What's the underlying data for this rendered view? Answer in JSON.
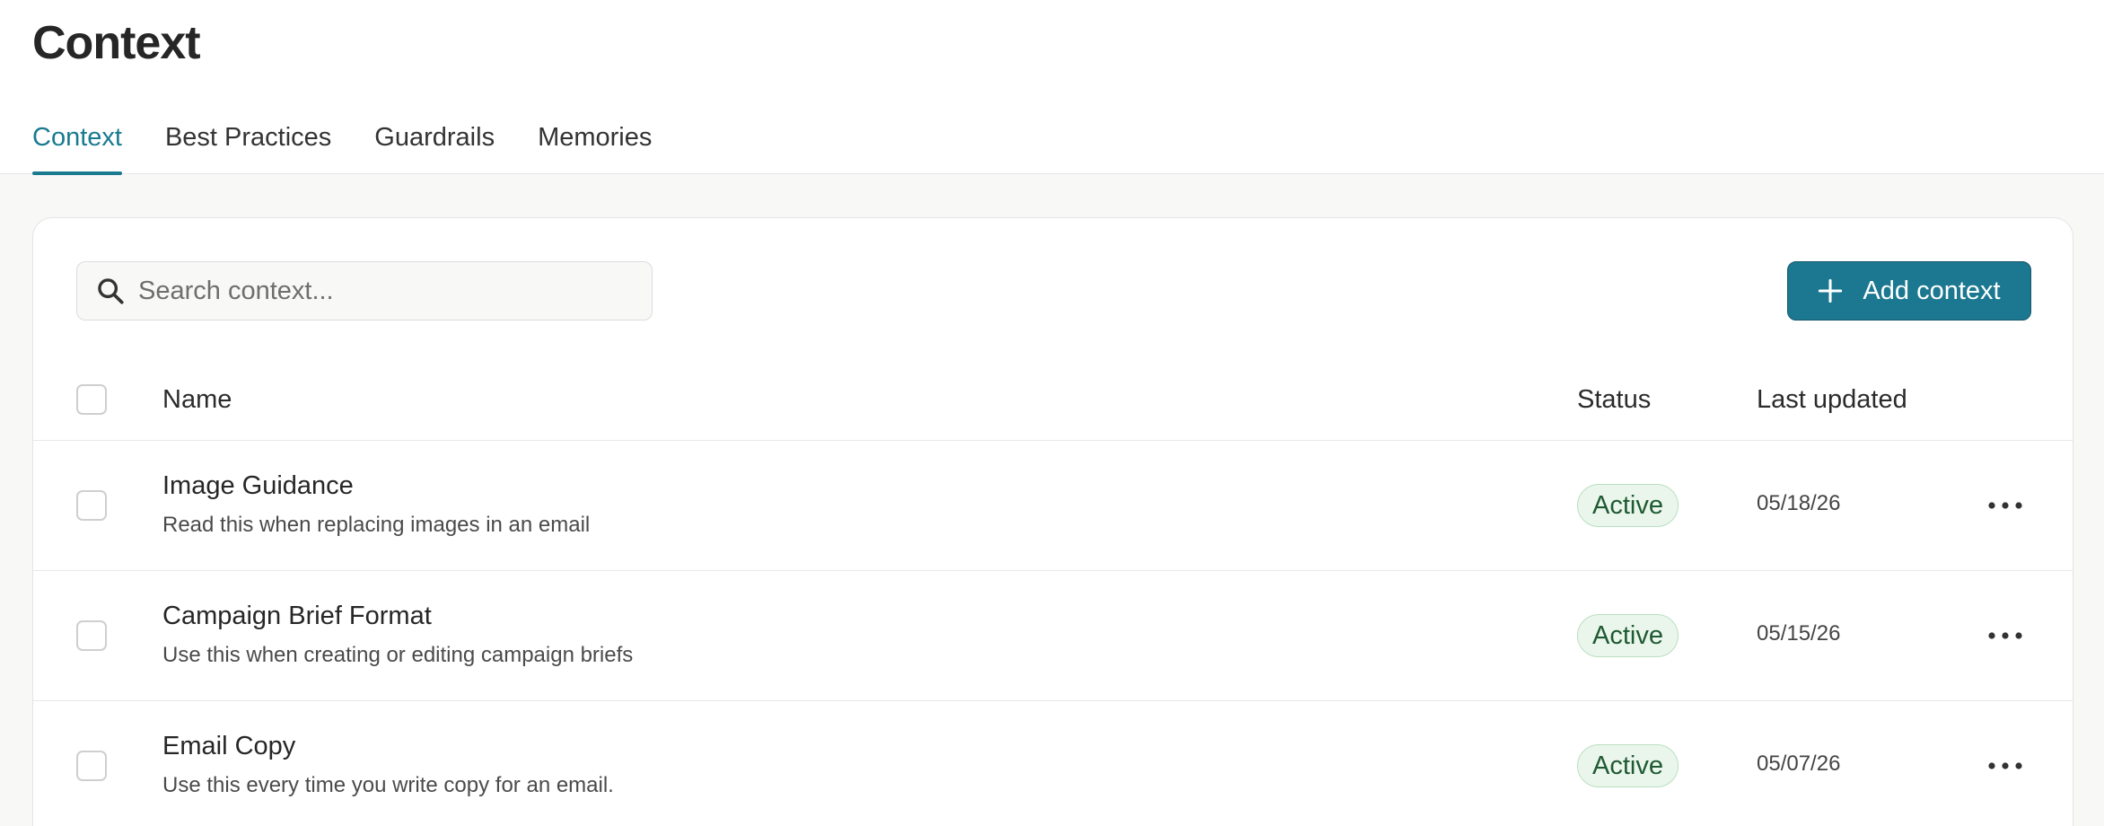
{
  "page": {
    "title": "Context"
  },
  "tabs": [
    {
      "label": "Context",
      "active": true
    },
    {
      "label": "Best Practices",
      "active": false
    },
    {
      "label": "Guardrails",
      "active": false
    },
    {
      "label": "Memories",
      "active": false
    }
  ],
  "search": {
    "placeholder": "Search context...",
    "value": "",
    "icon": "search-icon"
  },
  "toolbar": {
    "add_label": "Add context",
    "add_icon": "plus-icon"
  },
  "table": {
    "columns": {
      "name": "Name",
      "status": "Status",
      "updated": "Last updated"
    },
    "rows": [
      {
        "name": "Image Guidance",
        "description": "Read this when replacing images in an email",
        "status": "Active",
        "updated": "05/18/26"
      },
      {
        "name": "Campaign Brief Format",
        "description": "Use this when creating or editing campaign briefs",
        "status": "Active",
        "updated": "05/15/26"
      },
      {
        "name": "Email Copy",
        "description": "Use this every time you write copy for an email.",
        "status": "Active",
        "updated": "05/07/26"
      }
    ]
  },
  "colors": {
    "accent": "#1a7a8f",
    "button": "#1b7890",
    "status_bg": "#eaf6ec",
    "status_text": "#1f5a32"
  }
}
